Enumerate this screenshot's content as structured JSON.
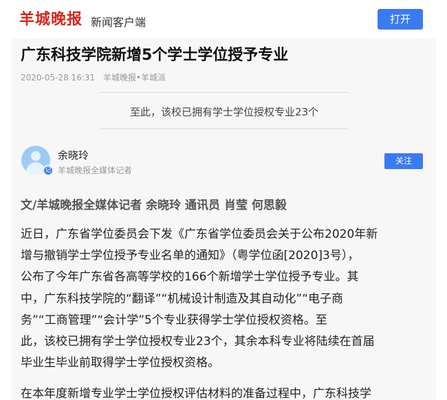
{
  "header": {
    "logo_text": "羊城晚报",
    "app_name": "新闻客户端",
    "open_label": "打开"
  },
  "article": {
    "title": "广东科技学院新增5个学士学位授予专业",
    "date": "2020-05-28 16:31",
    "source": "羊城晚报•羊城派",
    "summary": "至此，该校已拥有学士学位授权专业23个",
    "author": {
      "name": "余晓玲",
      "role": "羊城晚报全媒体记者",
      "badge": "记",
      "follow_label": "关注"
    },
    "byline": "文/羊城晚报全媒体记者 余晓玲 通讯员 肖莹 何思毅",
    "paragraph1_lines": [
      "近日，广东省学位委员会下发《广东省学位委员会关于公布2020年新",
      "增与撤销学士学位授予专业名单的通知》（粤学位函[2020]3号），",
      "公布了今年广东省各高等学校的166个新增学士学位授予专业。其",
      "中，广东科技学院的“翻译”“机械设计制造及其自动化”“电子商",
      "务”“工商管理”“会计学”5个专业获得学士学位授权资格。至",
      "此，该校已拥有学士学位授权专业23个，其余本科专业将陆续在首届",
      "毕业生毕业前取得学士学位授权资格。"
    ],
    "paragraph2_start": "在本年度新增专业学士学位授权评估材料的准备过程中，广东科技学"
  }
}
